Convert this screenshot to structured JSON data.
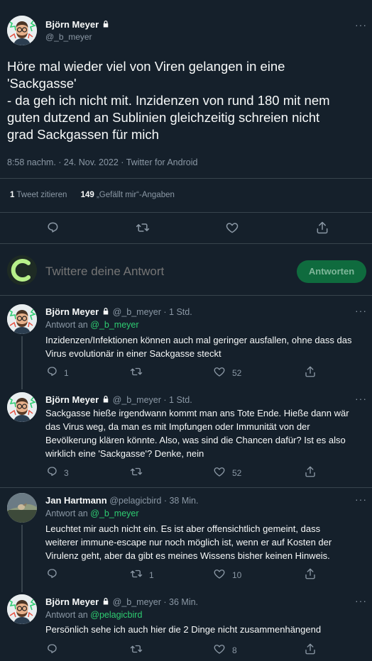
{
  "main_tweet": {
    "author_name": "Björn Meyer",
    "author_handle": "@_b_meyer",
    "text_lines": [
      "Höre mal wieder viel von Viren gelangen in eine",
      "'Sackgasse'",
      "- da geh ich nicht mit. Inzidenzen von rund 180 mit nem",
      "guten dutzend an Sublinien gleichzeitig schreien nicht",
      "grad Sackgassen für mich"
    ],
    "timestamp": "8:58 nachm. · 24. Nov. 2022 · Twitter for Android",
    "quote_count": "1",
    "quote_label": "Tweet zitieren",
    "like_count": "149",
    "like_label": "„Gefällt mir“-Angaben"
  },
  "reply_box": {
    "placeholder": "Twittere deine Antwort",
    "button_label": "Antworten"
  },
  "replies": [
    {
      "author_name": "Björn Meyer",
      "author_handle": "@_b_meyer",
      "time": "· 1 Std.",
      "reply_prefix": "Antwort an",
      "reply_to": "@_b_meyer",
      "text_lines": [
        "Inzidenzen/Infektionen können auch mal geringer ausfallen, ohne dass das",
        "Virus evolutionär in einer Sackgasse steckt"
      ],
      "reply_count": "1",
      "retweet_count": "",
      "like_count": "52"
    },
    {
      "author_name": "Björn Meyer",
      "author_handle": "@_b_meyer",
      "time": "· 1 Std.",
      "text_lines": [
        "Sackgasse hieße irgendwann kommt man ans Tote Ende. Hieße dann wär",
        "das Virus weg, da man es mit Impfungen oder Immunität von der",
        "Bevölkerung klären könnte. Also, was sind die Chancen dafür? Ist es also",
        "wirklich eine 'Sackgasse'? Denke, nein"
      ],
      "reply_count": "3",
      "retweet_count": "",
      "like_count": "52"
    },
    {
      "author_name": "Jan Hartmann",
      "author_handle": "@pelagicbird",
      "time": "· 38 Min.",
      "reply_prefix": "Antwort an",
      "reply_to": "@_b_meyer",
      "text_lines": [
        "Leuchtet mir auch nicht ein. Es ist aber offensichtlich gemeint, dass",
        "weiterer immune-escape nur noch möglich ist, wenn er auf Kosten der",
        "Virulenz geht, aber da gibt es meines Wissens bisher keinen Hinweis."
      ],
      "reply_count": "",
      "retweet_count": "1",
      "like_count": "10"
    },
    {
      "author_name": "Björn Meyer",
      "author_handle": "@_b_meyer",
      "time": "· 36 Min.",
      "reply_prefix": "Antwort an",
      "reply_to": "@pelagicbird",
      "text_lines": [
        "Persönlich sehe ich auch hier die 2 Dinge nicht zusammenhängend"
      ],
      "reply_count": "",
      "retweet_count": "",
      "like_count": "8"
    }
  ],
  "more_label": "···",
  "colors": {
    "background": "#15202b",
    "divider": "#38444d",
    "muted": "#8b98a5",
    "link": "#1d9bf0",
    "reply_to_link": "#2ecc71",
    "reply_button": "#0f6b3e"
  },
  "icons": [
    "lock-icon",
    "reply-icon",
    "retweet-icon",
    "like-icon",
    "share-icon",
    "more-icon"
  ]
}
